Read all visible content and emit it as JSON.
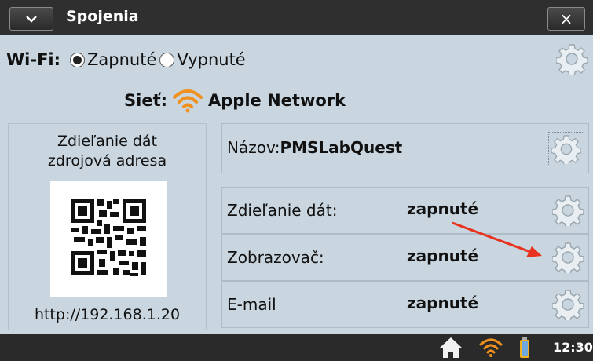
{
  "window": {
    "title": "Spojenia",
    "close_label": "×"
  },
  "wifi": {
    "label": "Wi-Fi:",
    "options": [
      {
        "label": "Zapnuté",
        "selected": true
      },
      {
        "label": "Vypnuté",
        "selected": false
      }
    ]
  },
  "network": {
    "label": "Sieť:",
    "name": "Apple Network"
  },
  "share_panel": {
    "title_line1": "Zdieľanie dát",
    "title_line2": "zdrojová adresa",
    "url": "http://192.168.1.20"
  },
  "device_name": {
    "label": "Názov:",
    "value": "PMSLabQuest"
  },
  "services": [
    {
      "label": "Zdieľanie dát:",
      "value": "zapnuté"
    },
    {
      "label": "Zobrazovač:",
      "value": "zapnuté"
    },
    {
      "label": "E-mail",
      "value": "zapnuté"
    }
  ],
  "taskbar": {
    "time": "12:30"
  },
  "colors": {
    "accent_orange": "#f0901e",
    "annotation_red": "#e8321e",
    "titlebar": "#2f2f2f",
    "background": "#c9d6e0"
  }
}
